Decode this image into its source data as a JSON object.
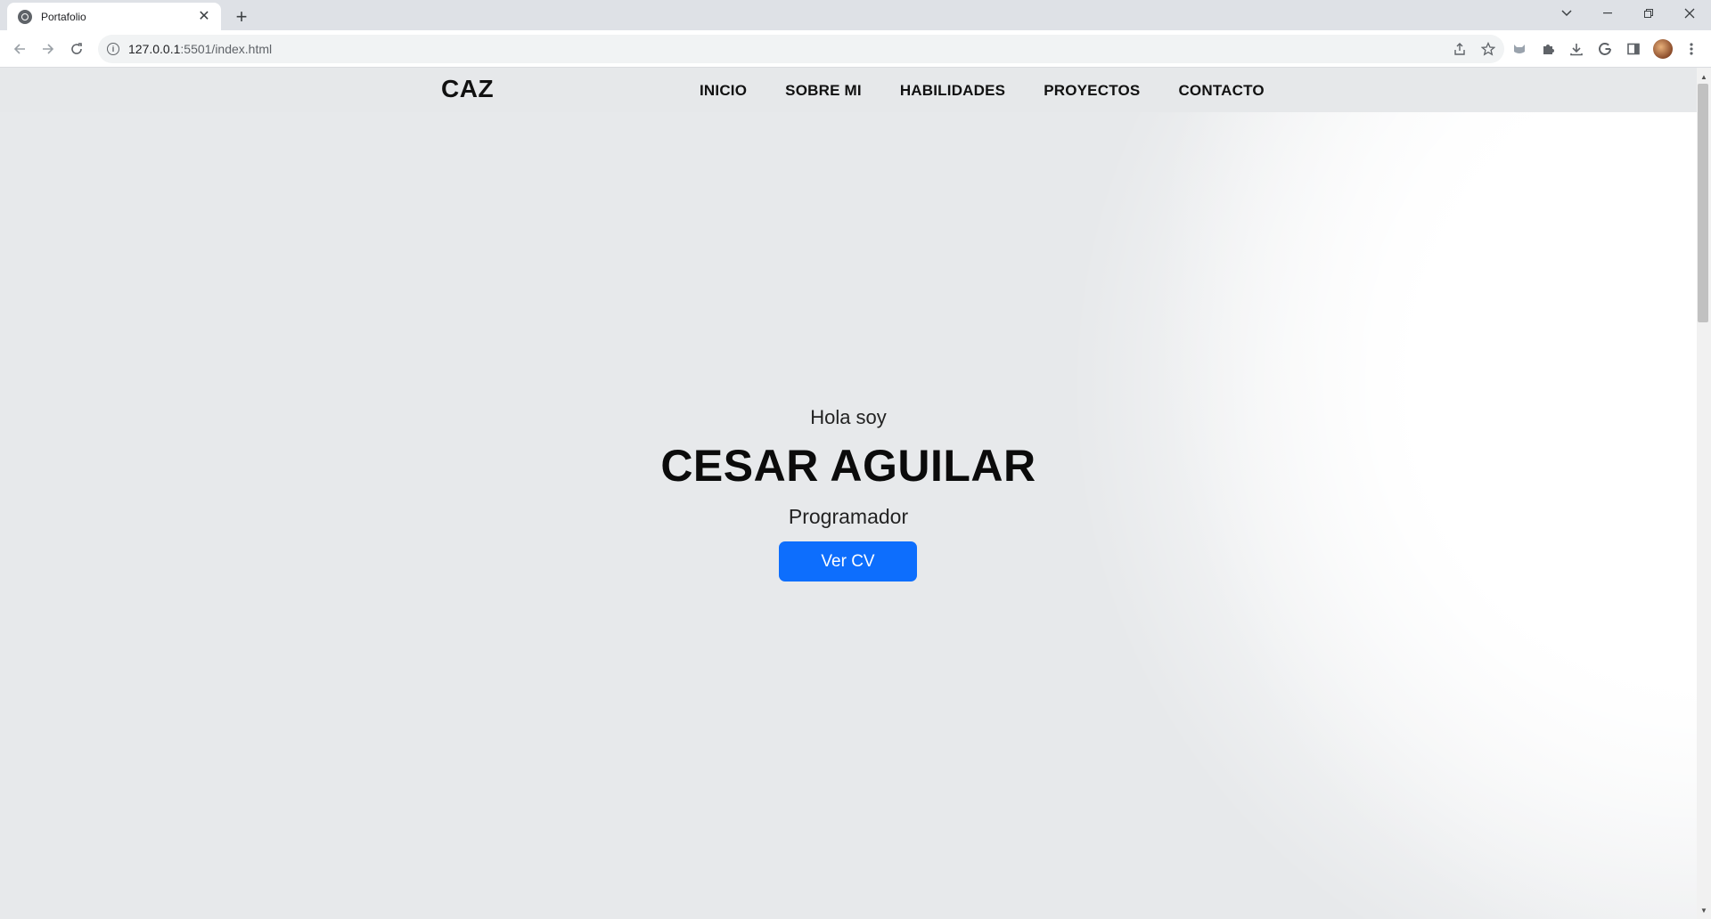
{
  "browser": {
    "tab_title": "Portafolio",
    "url_host": "127.0.0.1",
    "url_rest": ":5501/index.html"
  },
  "site": {
    "logo": "CAZ",
    "menu": [
      "INICIO",
      "SOBRE MI",
      "HABILIDADES",
      "PROYECTOS",
      "CONTACTO"
    ]
  },
  "hero": {
    "greeting": "Hola soy",
    "name": "CESAR AGUILAR",
    "role": "Programador",
    "button": "Ver CV"
  },
  "colors": {
    "accent": "#0d6efd",
    "nav_background": "#e6e8ea"
  }
}
